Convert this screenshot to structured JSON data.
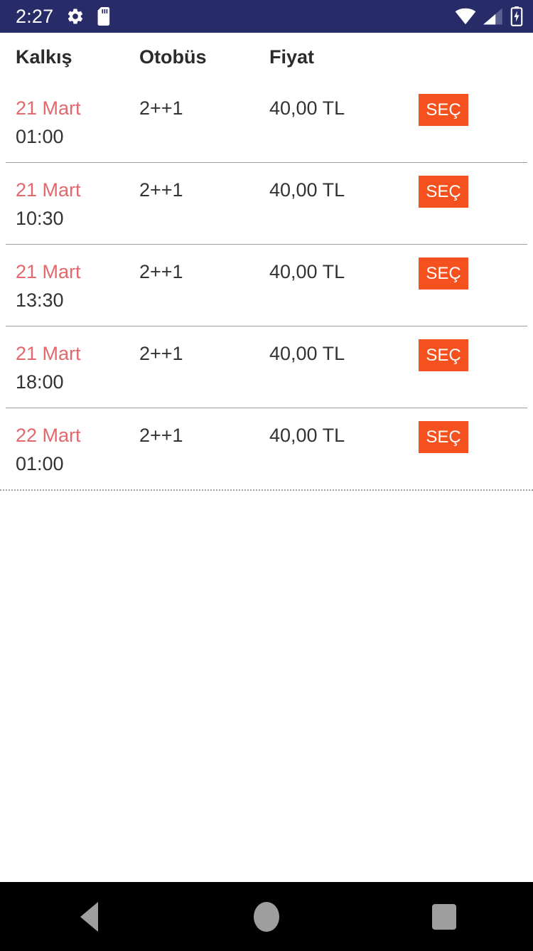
{
  "status_bar": {
    "time": "2:27",
    "background_color": "#272c68",
    "left_icons": [
      "gear-icon",
      "sd-card-icon"
    ],
    "right_icons": [
      "wifi-icon",
      "cell-signal-icon",
      "battery-charging-icon"
    ]
  },
  "table": {
    "headers": {
      "depart": "Kalkış",
      "bus": "Otobüs",
      "price": "Fiyat",
      "action": ""
    },
    "rows": [
      {
        "date": "21 Mart",
        "time": "01:00",
        "bus": "2++1",
        "price": "40,00 TL",
        "action_label": "SEÇ"
      },
      {
        "date": "21 Mart",
        "time": "10:30",
        "bus": "2++1",
        "price": "40,00 TL",
        "action_label": "SEÇ"
      },
      {
        "date": "21 Mart",
        "time": "13:30",
        "bus": "2++1",
        "price": "40,00 TL",
        "action_label": "SEÇ"
      },
      {
        "date": "21 Mart",
        "time": "18:00",
        "bus": "2++1",
        "price": "40,00 TL",
        "action_label": "SEÇ"
      },
      {
        "date": "22 Mart",
        "time": "01:00",
        "bus": "2++1",
        "price": "40,00 TL",
        "action_label": "SEÇ"
      }
    ]
  },
  "colors": {
    "accent_button": "#f4511e",
    "date_text": "#e2686c",
    "status_bar": "#272c68",
    "body_text": "#333333",
    "separator": "#9e9e9e"
  },
  "nav_bar": {
    "buttons": [
      "back-button",
      "home-button",
      "recents-button"
    ],
    "background_color": "#000000"
  }
}
